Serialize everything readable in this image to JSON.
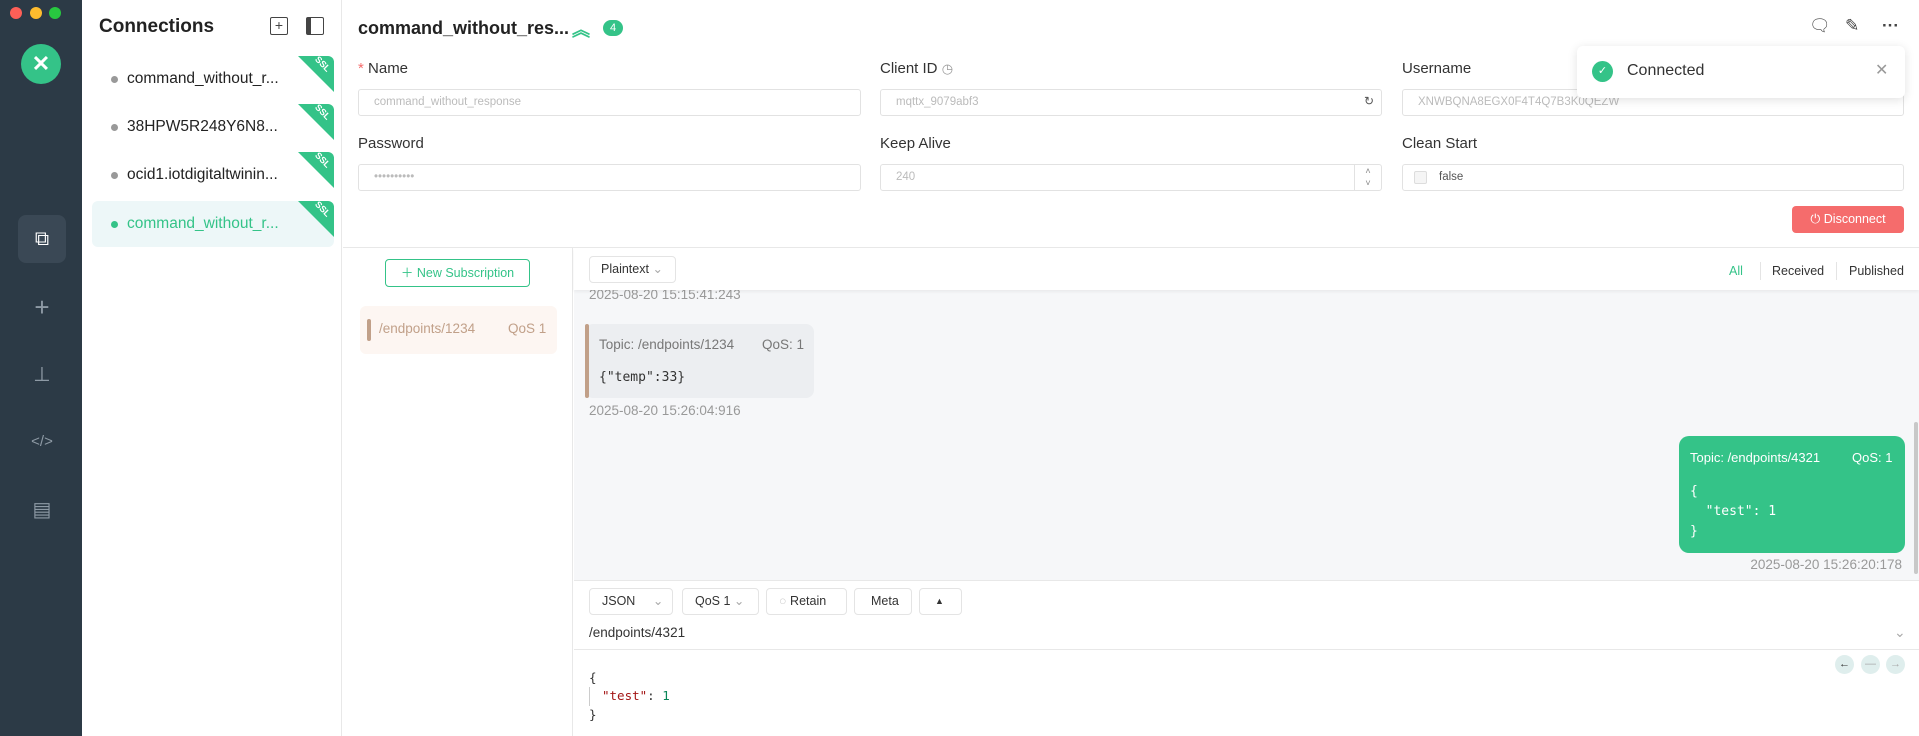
{
  "colors": {
    "accent": "#34c388",
    "danger": "#f56c6c",
    "sidebar": "#2c3a46",
    "received_bar": "#c1a089"
  },
  "window": {
    "controls": [
      "close",
      "minimize",
      "maximize"
    ]
  },
  "nav": {
    "logo": "mqttx-logo",
    "items": [
      {
        "icon": "connections-icon",
        "active": true
      },
      {
        "icon": "plus-icon"
      },
      {
        "icon": "topology-icon"
      },
      {
        "icon": "code-icon"
      },
      {
        "icon": "log-icon"
      }
    ]
  },
  "connections": {
    "title": "Connections",
    "items": [
      {
        "label": "command_without_r...",
        "badge": "SSL",
        "status": "offline"
      },
      {
        "label": "38HPW5R248Y6N8...",
        "badge": "SSL",
        "status": "offline"
      },
      {
        "label": "ocid1.iotdigitaltwinin...",
        "badge": "SSL",
        "status": "offline"
      },
      {
        "label": "command_without_r...",
        "badge": "SSL",
        "status": "online",
        "active": true
      }
    ]
  },
  "header": {
    "title": "command_without_res...",
    "count": "4"
  },
  "form": {
    "name": {
      "label": "Name",
      "required": "*",
      "value": "command_without_response"
    },
    "client_id": {
      "label": "Client ID",
      "value": "mqttx_9079abf3"
    },
    "username": {
      "label": "Username",
      "value": "XNWBQNA8EGX0F4T4Q7B3K0QEZW"
    },
    "password": {
      "label": "Password",
      "value": "••••••••••"
    },
    "keep_alive": {
      "label": "Keep Alive",
      "value": "240"
    },
    "clean_start": {
      "label": "Clean Start",
      "value": "false"
    },
    "disconnect": "Disconnect"
  },
  "toast": {
    "message": "Connected"
  },
  "subscriptions": {
    "new_label": "New Subscription",
    "items": [
      {
        "topic": "/endpoints/1234",
        "qos": "QoS 1"
      }
    ]
  },
  "messages": {
    "format": "Plaintext",
    "filters": [
      "All",
      "Received",
      "Published"
    ],
    "partial_timestamp": "2025-08-20 15:15:41:243",
    "received": {
      "topic": "Topic: /endpoints/1234",
      "qos": "QoS: 1",
      "payload": "{\"temp\":33}",
      "time": "2025-08-20 15:26:04:916"
    },
    "sent": {
      "topic": "Topic: /endpoints/4321",
      "qos": "QoS: 1",
      "payload": [
        "{",
        "  \"test\": 1",
        "}"
      ],
      "time": "2025-08-20 15:26:20:178"
    }
  },
  "publish": {
    "format": "JSON",
    "qos": "QoS 1",
    "retain": "Retain",
    "meta": "Meta",
    "topic": "/endpoints/4321",
    "code": [
      "{",
      "\"test\"",
      ": ",
      "1",
      "}"
    ]
  }
}
